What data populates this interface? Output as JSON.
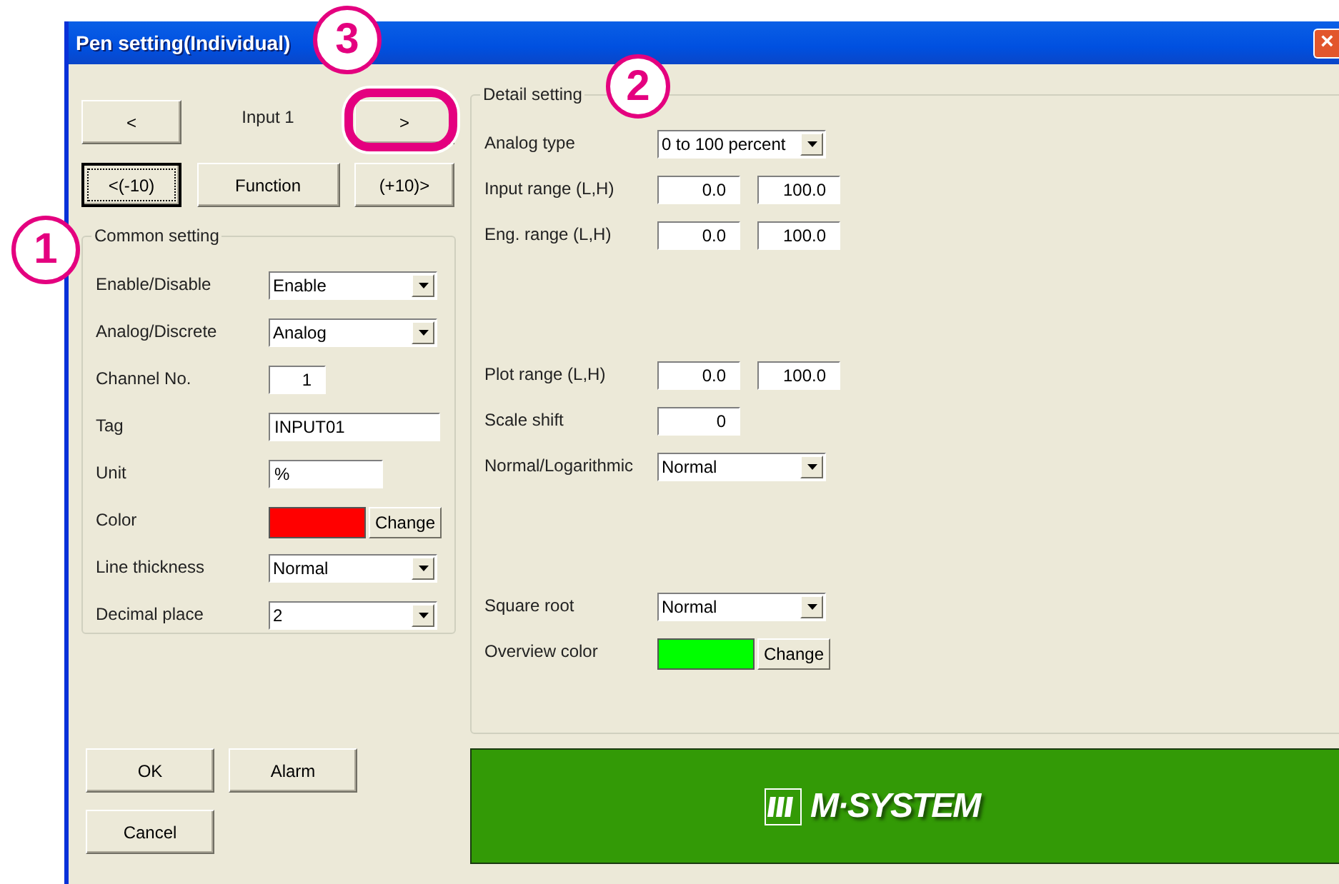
{
  "window": {
    "title": "Pen setting(Individual)",
    "close": "×"
  },
  "navigation": {
    "rows": [
      [
        {
          "kind": "button",
          "label": "<",
          "focused": false,
          "highlighted": false
        },
        {
          "kind": "label",
          "label": "Input 1"
        },
        {
          "kind": "button",
          "label": ">",
          "focused": false,
          "highlighted": true
        }
      ],
      [
        {
          "kind": "button",
          "label": "<(-10)",
          "focused": true,
          "highlighted": false
        },
        {
          "kind": "button",
          "label": "Function",
          "focused": false,
          "highlighted": false
        },
        {
          "kind": "button",
          "label": "(+10)>",
          "focused": false,
          "highlighted": false
        }
      ]
    ]
  },
  "common_setting": {
    "title": "Common setting",
    "rows": [
      {
        "label": "Enable/Disable",
        "kind": "dropdown",
        "value": "Enable"
      },
      {
        "label": "Analog/Discrete",
        "kind": "dropdown",
        "value": "Analog"
      },
      {
        "label": "Channel No.",
        "kind": "number",
        "value": "1"
      },
      {
        "label": "Tag",
        "kind": "text",
        "value": "INPUT01"
      },
      {
        "label": "Unit",
        "kind": "text",
        "value": "%"
      },
      {
        "label": "Color",
        "kind": "color",
        "color": "#ff0000",
        "button": "Change"
      },
      {
        "label": "Line thickness",
        "kind": "dropdown",
        "value": "Normal"
      },
      {
        "label": "Decimal place",
        "kind": "dropdown",
        "value": "2"
      }
    ]
  },
  "detail_setting": {
    "title": "Detail setting",
    "sections": [
      [
        {
          "label": "Analog type",
          "kind": "dropdown",
          "value": "0 to 100 percent"
        },
        {
          "label": "Input range (L,H)",
          "kind": "pair",
          "values": [
            "0.0",
            "100.0"
          ]
        },
        {
          "label": "Eng. range (L,H)",
          "kind": "pair",
          "values": [
            "0.0",
            "100.0"
          ]
        }
      ],
      [
        {
          "label": "Plot range (L,H)",
          "kind": "pair",
          "values": [
            "0.0",
            "100.0"
          ]
        },
        {
          "label": "Scale shift",
          "kind": "number",
          "value": "0"
        },
        {
          "label": "Normal/Logarithmic",
          "kind": "dropdown",
          "value": "Normal"
        }
      ],
      [
        {
          "label": "Square root",
          "kind": "dropdown",
          "value": "Normal"
        },
        {
          "label": "Overview color",
          "kind": "color",
          "color": "#00ff00",
          "button": "Change"
        }
      ]
    ]
  },
  "buttons": [
    {
      "label": "OK"
    },
    {
      "label": "Alarm"
    },
    {
      "label": "Cancel"
    }
  ],
  "banner": {
    "logo": "M·SYSTEM"
  },
  "annotations": [
    {
      "label": "1"
    },
    {
      "label": "2"
    },
    {
      "label": "3"
    }
  ]
}
